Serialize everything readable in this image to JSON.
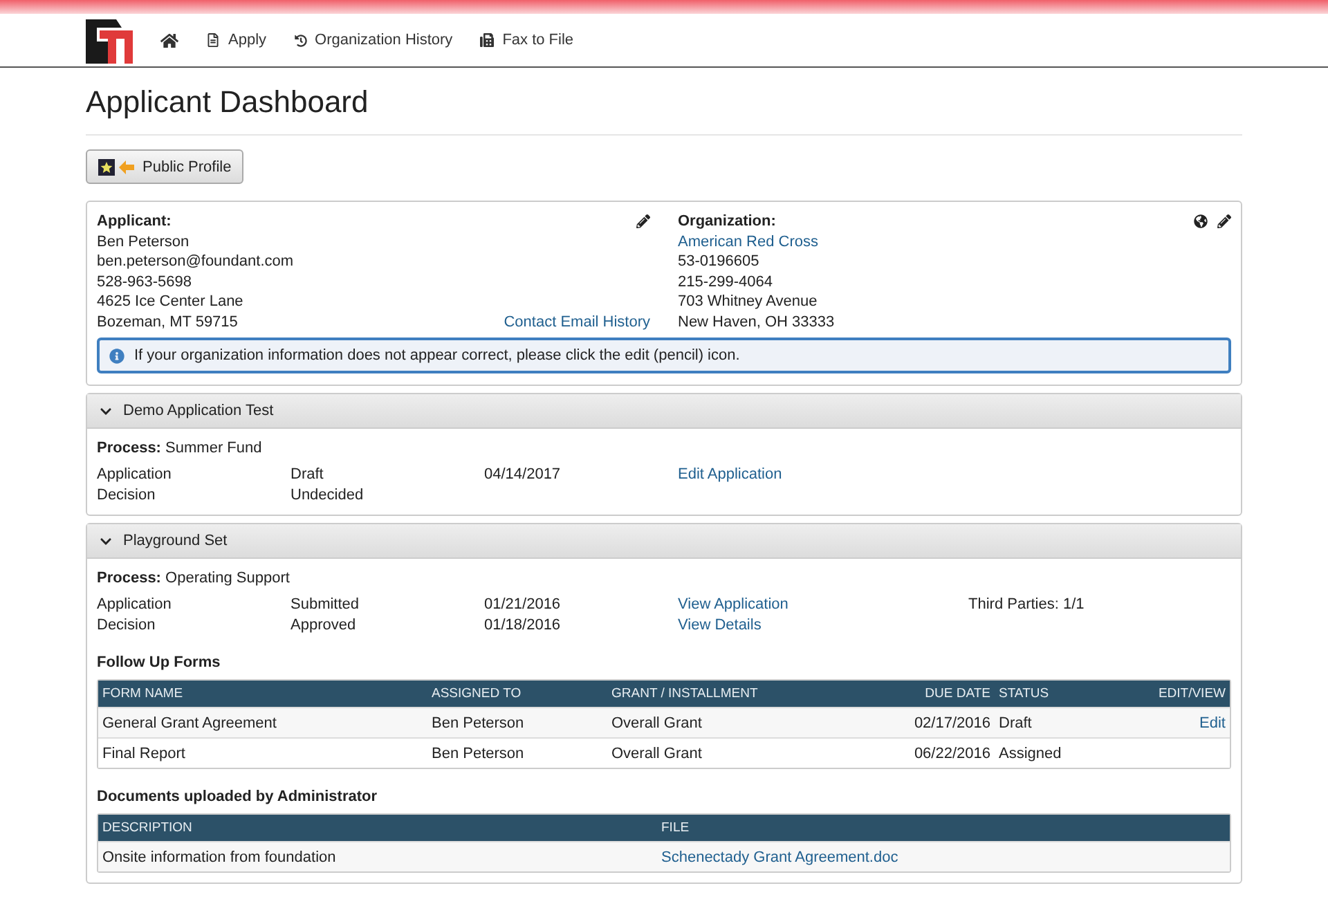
{
  "nav": [
    {
      "kind": "home"
    },
    {
      "kind": "apply",
      "label": "Apply"
    },
    {
      "kind": "history",
      "label": "Organization History"
    },
    {
      "kind": "fax",
      "label": "Fax to File"
    }
  ],
  "page_title": "Applicant Dashboard",
  "public_profile_button": "Public Profile",
  "applicant": {
    "heading": "Applicant:",
    "lines": [
      "Ben Peterson",
      "ben.peterson@foundant.com",
      "528-963-5698",
      "4625 Ice Center Lane",
      "Bozeman, MT 59715"
    ],
    "link": "Contact Email History"
  },
  "organization": {
    "heading": "Organization:",
    "name": "American Red Cross",
    "lines": [
      "53-0196605",
      "215-299-4064",
      "703 Whitney Avenue",
      "New Haven, OH 33333"
    ]
  },
  "info_notice": "If your organization information does not appear correct, please click the edit (pencil) icon.",
  "applications": [
    {
      "title": "Demo Application Test",
      "expanded": true,
      "process": "**Process:** Summer Fund",
      "rows": [
        {
          "label": "Application",
          "status": "Draft",
          "date": "04/14/2017",
          "link": "Edit Application"
        },
        {
          "label": "Decision",
          "status": "Undecided"
        }
      ]
    },
    {
      "title": "Playground Set",
      "expanded": true,
      "process": "**Process:** Operating Support",
      "rows": [
        {
          "label": "Application",
          "status": "Submitted",
          "date": "01/21/2016",
          "link": "View Application",
          "note": "Third Parties: 1/1"
        },
        {
          "label": "Decision",
          "status": "Approved",
          "date": "01/18/2016",
          "link": "View Details"
        }
      ],
      "tables": [
        {
          "title": "Follow Up Forms",
          "columns": [
            "FORM NAME",
            "ASSIGNED TO",
            "GRANT / INSTALLMENT",
            "DUE DATE",
            "STATUS",
            "EDIT/VIEW"
          ],
          "rows": [
            [
              "General Grant Agreement",
              "Ben Peterson",
              "Overall Grant",
              "02/17/2016",
              "Draft",
              "Edit"
            ],
            [
              "Final Report",
              "Ben Peterson",
              "Overall Grant",
              "06/22/2016",
              "Assigned",
              ""
            ]
          ]
        },
        {
          "title": "Documents uploaded by Administrator",
          "columns": [
            "DESCRIPTION",
            "FILE"
          ],
          "rows": [
            [
              "Onsite information from foundation",
              "Schenectady Grant Agreement.doc"
            ]
          ]
        }
      ]
    }
  ]
}
